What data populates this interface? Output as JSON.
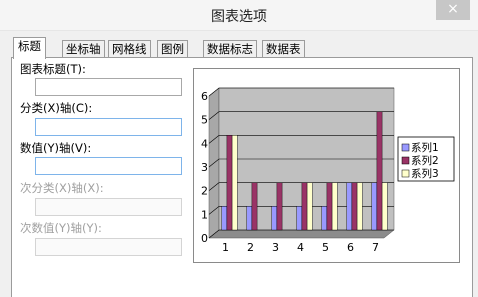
{
  "dialog": {
    "title": "图表选项",
    "close_glyph": "×"
  },
  "tabs": [
    {
      "label": "标题",
      "active": true
    },
    {
      "label": "坐标轴",
      "active": false
    },
    {
      "label": "网格线",
      "active": false
    },
    {
      "label": "图例",
      "active": false
    },
    {
      "label": "数据标志",
      "active": false
    },
    {
      "label": "数据表",
      "active": false
    }
  ],
  "fields": {
    "chart_title": {
      "label": "图表标题(T):",
      "value": ""
    },
    "category_x": {
      "label": "分类(X)轴(C):",
      "value": ""
    },
    "value_y": {
      "label": "数值(Y)轴(V):",
      "value": ""
    },
    "secondary_category_x": {
      "label": "次分类(X)轴(X):",
      "value": ""
    },
    "secondary_value_y": {
      "label": "次数值(Y)轴(Y):",
      "value": ""
    }
  },
  "chart_data": {
    "type": "bar",
    "categories": [
      "1",
      "2",
      "3",
      "4",
      "5",
      "6",
      "7"
    ],
    "series": [
      {
        "name": "系列1",
        "values": [
          1,
          1,
          1,
          1,
          1,
          2,
          2
        ]
      },
      {
        "name": "系列2",
        "values": [
          4,
          2,
          2,
          2,
          2,
          2,
          5
        ]
      },
      {
        "name": "系列3",
        "values": [
          4,
          0,
          0,
          2,
          2,
          2,
          2
        ]
      }
    ],
    "series_colors": [
      "#9999ff",
      "#993366",
      "#ffffcc"
    ],
    "plot_background": "#c0c0c0",
    "ylim": [
      0,
      6
    ],
    "yticks": [
      "0",
      "1",
      "2",
      "3",
      "4",
      "5",
      "6"
    ],
    "grid": true,
    "legend_position": "right"
  }
}
